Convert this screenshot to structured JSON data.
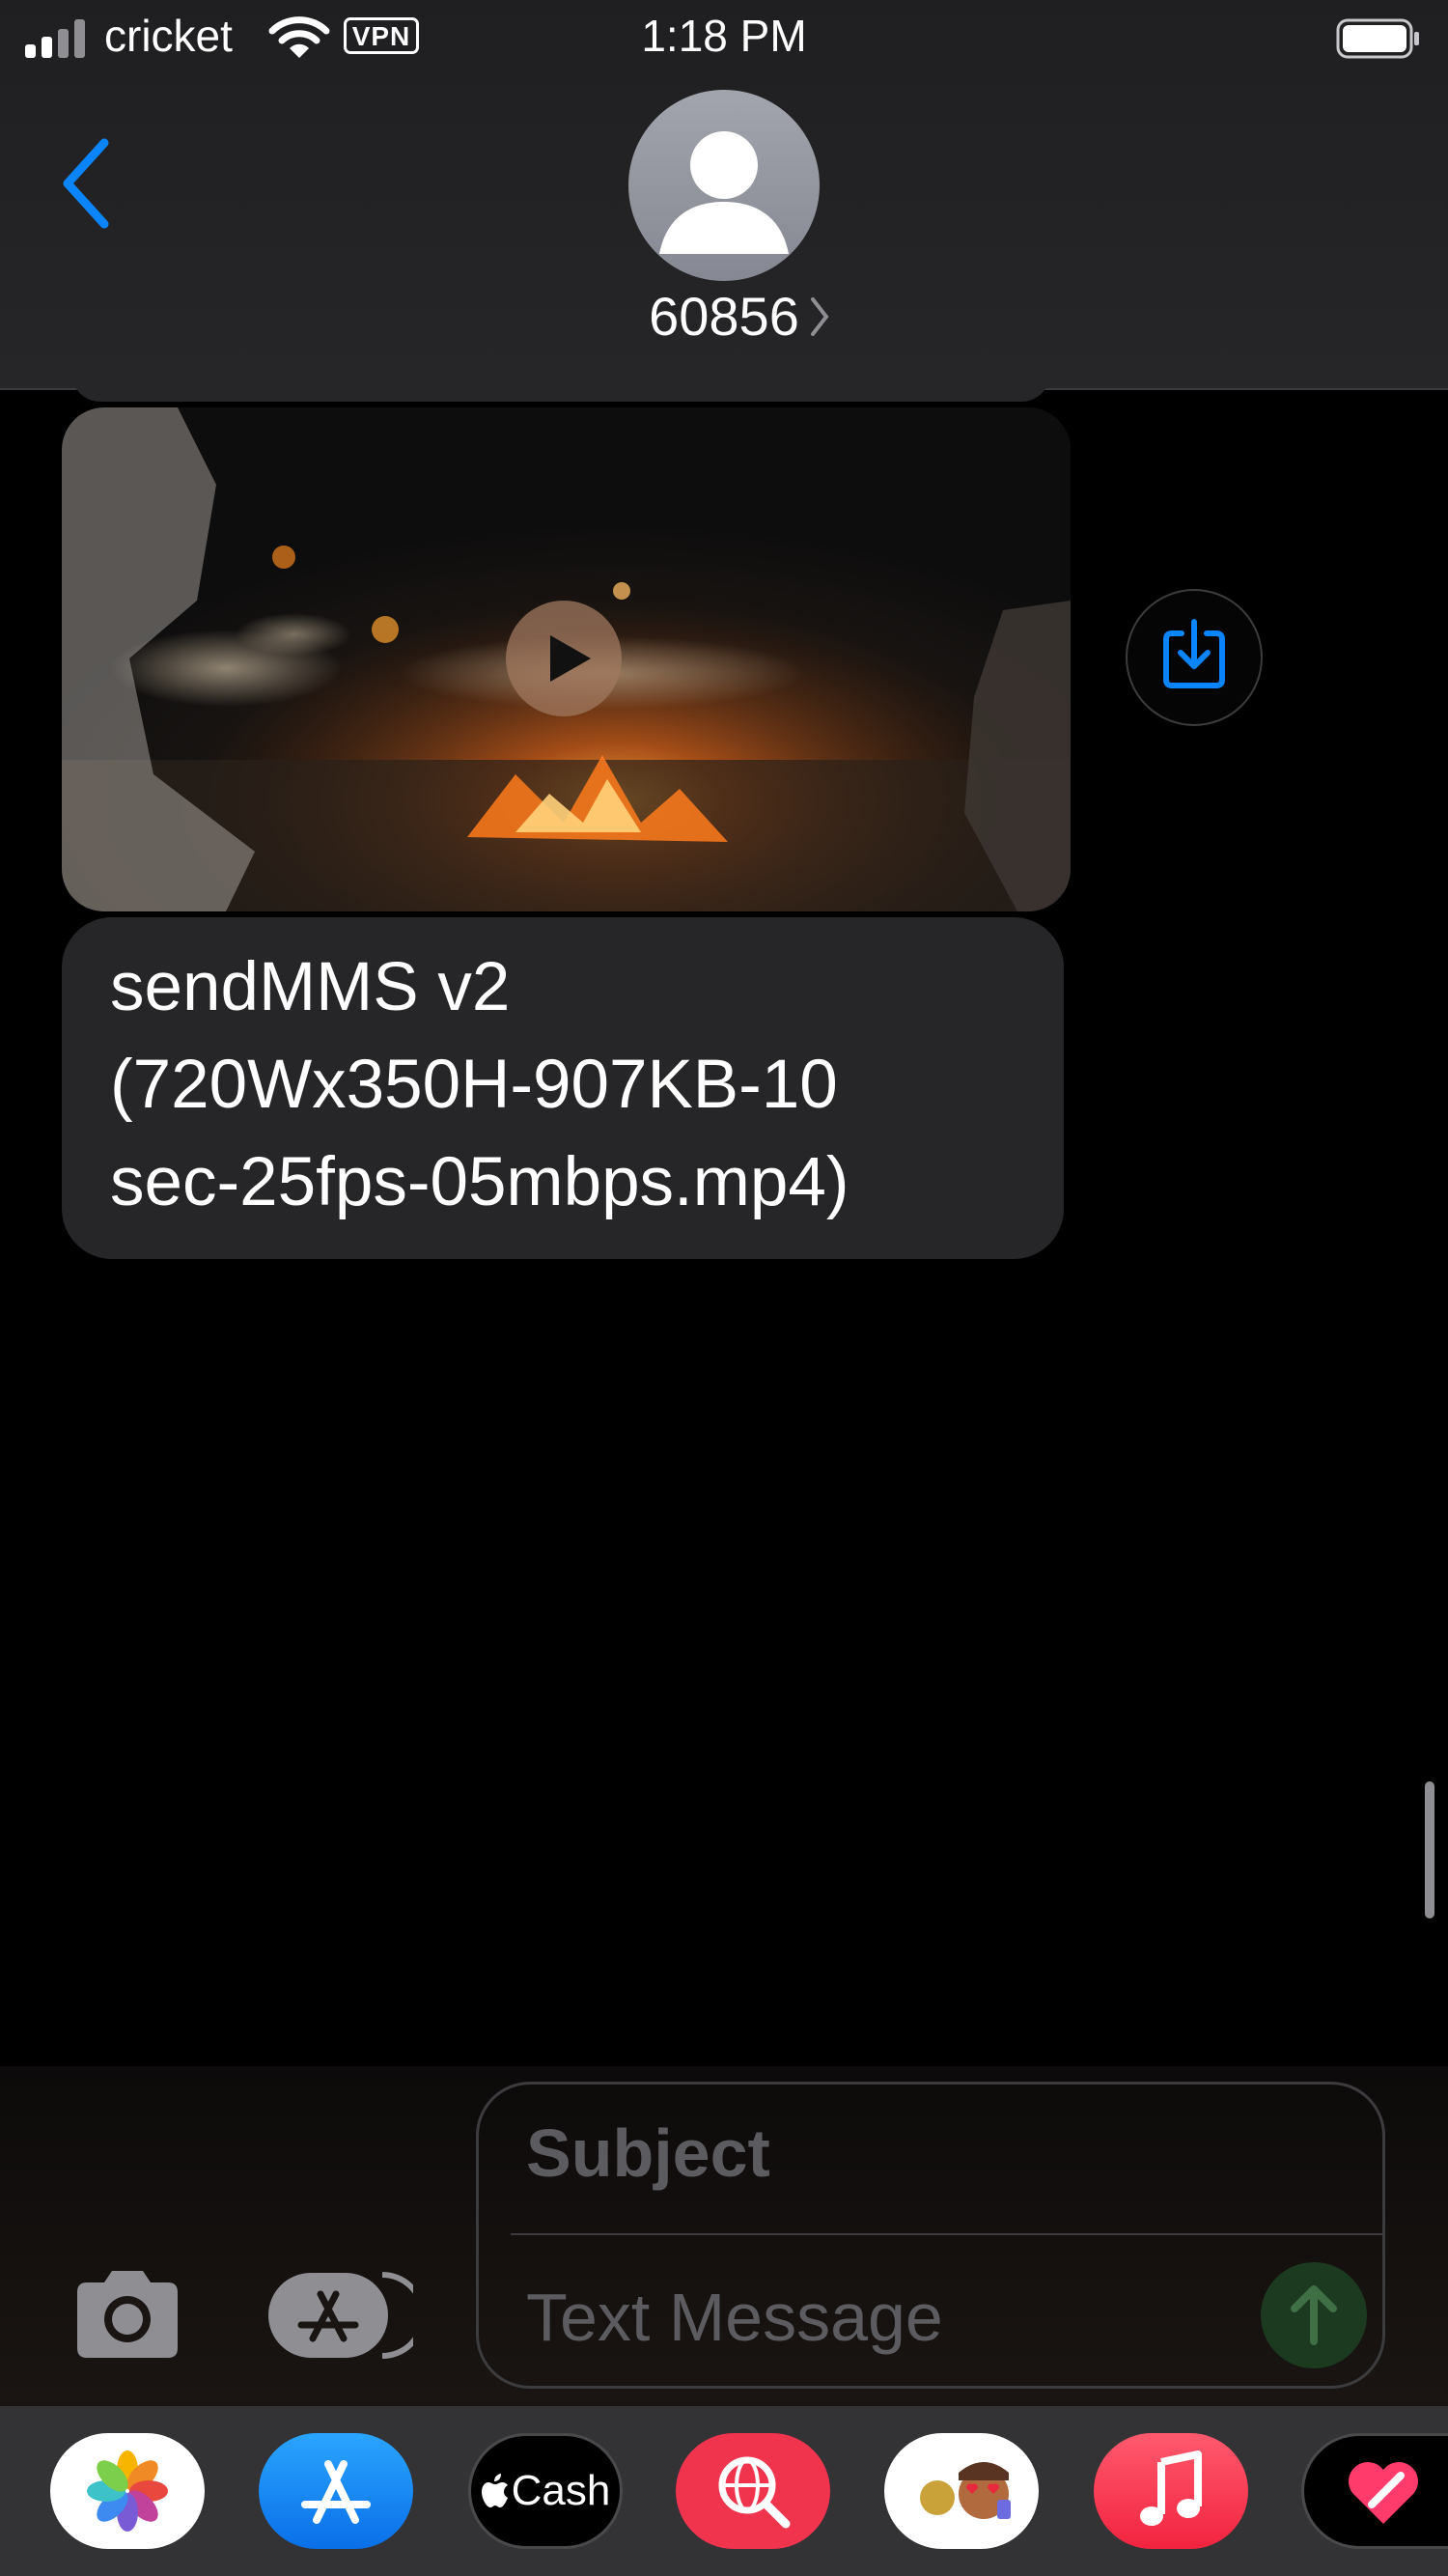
{
  "status_bar": {
    "carrier": "cricket",
    "vpn": "VPN",
    "time": "1:18 PM"
  },
  "header": {
    "contact_name": "60856",
    "icons": [
      "back-chevron-icon",
      "avatar-person-icon",
      "chevron-right-icon"
    ]
  },
  "messages": {
    "video": {
      "icons": [
        "play-icon",
        "save-download-icon"
      ]
    },
    "text_lines": [
      "sendMMS v2",
      "(720Wx350H-907KB-10",
      "sec-25fps-05mbps.mp4)"
    ]
  },
  "compose": {
    "subject_placeholder": "Subject",
    "message_placeholder": "Text Message",
    "icons": [
      "camera-icon",
      "app-store-icon",
      "send-arrow-icon"
    ]
  },
  "app_drawer": {
    "apps": [
      {
        "name": "Photos",
        "icon": "photos-icon"
      },
      {
        "name": "App Store",
        "icon": "app-store-icon"
      },
      {
        "name": "Apple Cash",
        "icon": "apple-cash-icon",
        "label": "Cash"
      },
      {
        "name": "Image Search",
        "icon": "globe-search-icon"
      },
      {
        "name": "Memoji",
        "icon": "memoji-icon"
      },
      {
        "name": "Music",
        "icon": "music-note-icon"
      },
      {
        "name": "Digital Touch",
        "icon": "heart-icon"
      }
    ]
  },
  "colors": {
    "accent_blue": "#0a84ff",
    "bubble_gray": "#262628",
    "placeholder_gray": "#5c5c60",
    "drawer_bg": "#333336"
  }
}
